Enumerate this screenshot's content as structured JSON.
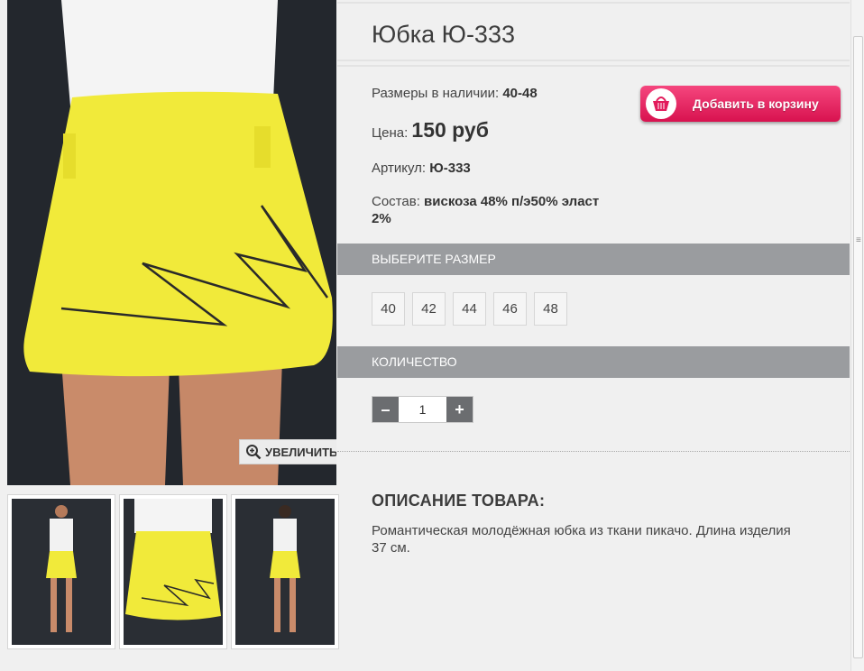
{
  "product": {
    "title": "Юбка Ю-333",
    "sizes_label": "Размеры в наличии:",
    "sizes_value": "40-48",
    "price_label": "Цена:",
    "price_value": "150 руб",
    "article_label": "Артикул:",
    "article_value": "Ю-333",
    "composition_label": "Состав:",
    "composition_value_line1": "вискоза 48% п/э50% эласт",
    "composition_value_line2": "2%"
  },
  "cart": {
    "label": "Добавить в корзину",
    "icon": "basket-icon"
  },
  "zoom": {
    "label": "УВЕЛИЧИТЬ",
    "icon": "magnifier-plus-icon"
  },
  "size_section": {
    "title": "ВЫБЕРИТЕ РАЗМЕР",
    "options": [
      "40",
      "42",
      "44",
      "46",
      "48"
    ]
  },
  "quantity_section": {
    "title": "КОЛИЧЕСТВО",
    "minus": "–",
    "plus": "+",
    "value": "1"
  },
  "description": {
    "heading": "ОПИСАНИЕ ТОВАРА:",
    "text": "Романтическая молодёжная юбка из ткани пикачо. Длина изделия 37 см."
  },
  "colors": {
    "accent": "#e21c5c",
    "bar": "#9a9c9f",
    "skirt": "#f1ea3a"
  }
}
